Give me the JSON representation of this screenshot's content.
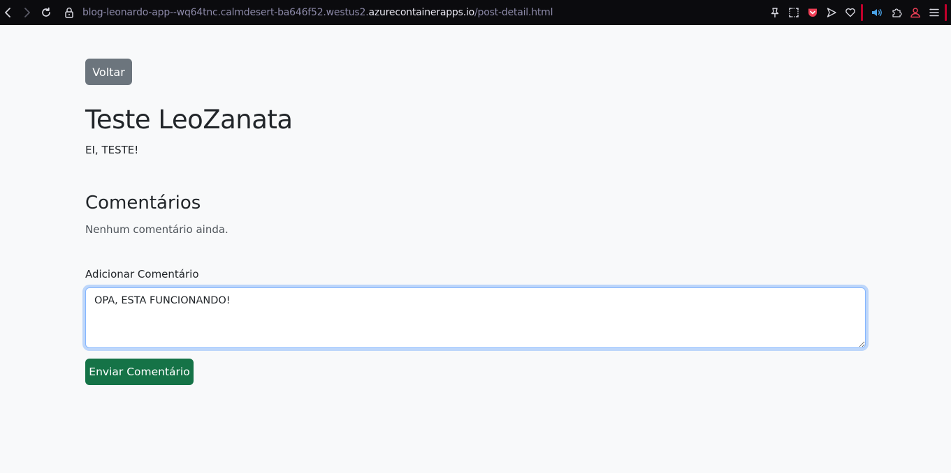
{
  "browser": {
    "url_prefix": "blog-leonardo-app--wq64tnc.calmdesert-ba646f52.westus2.",
    "url_domain": "azurecontainerapps.io",
    "url_path": "/post-detail.html",
    "icons": {
      "back": "arrow-left-icon",
      "forward": "arrow-right-icon",
      "reload": "reload-icon",
      "lock": "lock-icon",
      "pin": "pin-icon",
      "screenshot": "screenshot-icon",
      "pocket": "pocket-icon",
      "send": "send-icon",
      "heart": "heart-icon",
      "audio": "speaker-icon",
      "extensions": "puzzle-icon",
      "profile": "profile-icon",
      "menu": "menu-icon"
    },
    "colors": {
      "toolbar_bg": "#0b0b0e",
      "accent": "#c0002b"
    }
  },
  "page": {
    "back_label": "Voltar",
    "post_title": "Teste LeoZanata",
    "post_body": "EI, TESTE!",
    "comments_heading": "Comentários",
    "no_comments_text": "Nenhum comentário ainda.",
    "add_comment_label": "Adicionar Comentário",
    "comment_value": "OPA, ESTA FUNCIONANDO!",
    "send_label": "Enviar Comentário",
    "colors": {
      "background": "#f8f9fa",
      "back_button": "#6c757d",
      "send_button": "#157347",
      "focus_border": "#86b7fe"
    }
  }
}
